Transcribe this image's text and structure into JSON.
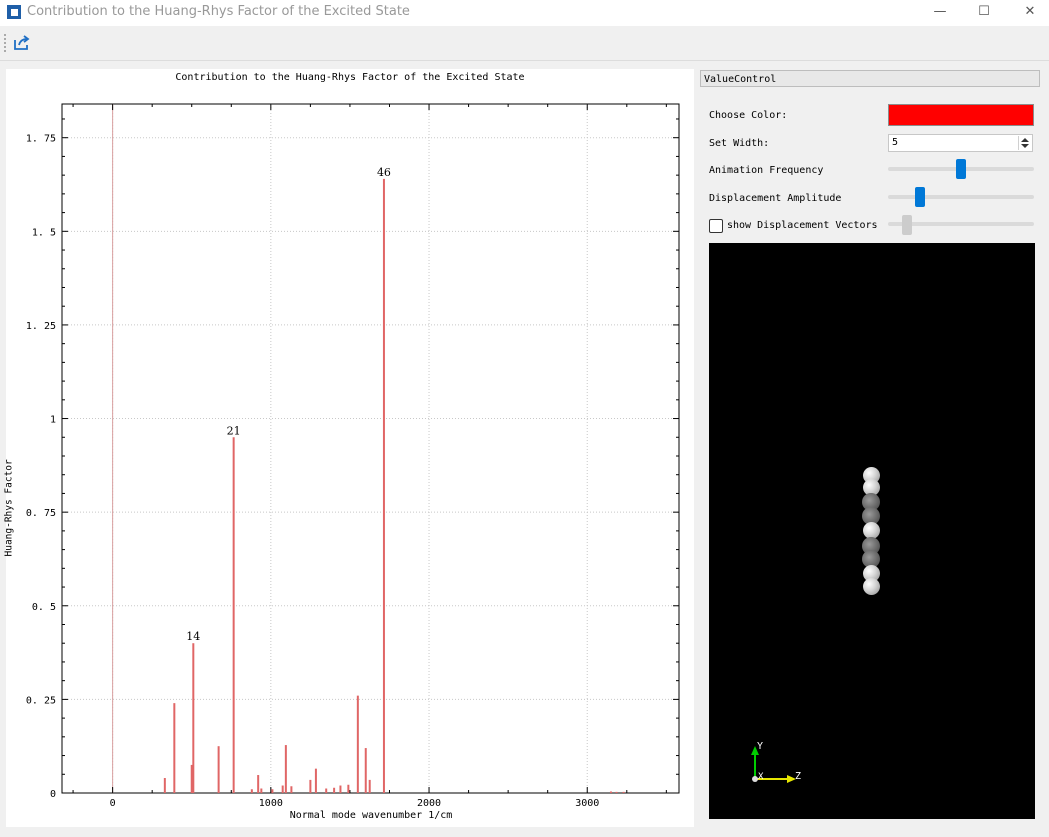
{
  "window": {
    "title": "Contribution to the Huang-Rhys Factor of the Excited State",
    "minimize": "—",
    "maximize": "☐",
    "close": "✕"
  },
  "toolbar": {
    "export_icon": "export-icon"
  },
  "chart_data": {
    "type": "bar",
    "title": "Contribution to the Huang-Rhys Factor of the Excited State",
    "xlabel": "Normal mode wavenumber 1/cm",
    "ylabel": "Huang-Rhys Factor",
    "xlim": [
      -320,
      3580
    ],
    "ylim": [
      0,
      1.84
    ],
    "xticks": [
      0,
      1000,
      2000,
      3000
    ],
    "yticks": [
      0,
      0.25,
      0.5,
      0.75,
      1,
      1.25,
      1.5,
      1.75
    ],
    "ytick_labels": [
      "0",
      "0. 25",
      "0. 5",
      "0. 75",
      "1",
      "1. 25",
      "1. 5",
      "1. 75"
    ],
    "grid": true,
    "bar_color": "#e06666",
    "bars": [
      {
        "x": 330,
        "y": 0.04
      },
      {
        "x": 390,
        "y": 0.24
      },
      {
        "x": 500,
        "y": 0.075
      },
      {
        "x": 510,
        "y": 0.4,
        "label": "14"
      },
      {
        "x": 670,
        "y": 0.125
      },
      {
        "x": 765,
        "y": 0.95,
        "label": "21"
      },
      {
        "x": 880,
        "y": 0.01
      },
      {
        "x": 920,
        "y": 0.048
      },
      {
        "x": 940,
        "y": 0.012
      },
      {
        "x": 1010,
        "y": 0.01
      },
      {
        "x": 1075,
        "y": 0.02
      },
      {
        "x": 1095,
        "y": 0.128
      },
      {
        "x": 1130,
        "y": 0.018
      },
      {
        "x": 1250,
        "y": 0.035
      },
      {
        "x": 1285,
        "y": 0.065
      },
      {
        "x": 1350,
        "y": 0.012
      },
      {
        "x": 1400,
        "y": 0.014
      },
      {
        "x": 1440,
        "y": 0.02
      },
      {
        "x": 1490,
        "y": 0.022
      },
      {
        "x": 1550,
        "y": 0.26
      },
      {
        "x": 1600,
        "y": 0.12
      },
      {
        "x": 1625,
        "y": 0.035
      },
      {
        "x": 1715,
        "y": 1.64,
        "label": "46"
      },
      {
        "x": 3150,
        "y": 0.004
      },
      {
        "x": 3185,
        "y": 0.003
      },
      {
        "x": 3230,
        "y": 0.003
      }
    ]
  },
  "controls": {
    "header": "ValueControl",
    "choose_color_label": "Choose Color:",
    "color": "#ff0000",
    "set_width_label": "Set Width:",
    "width_value": "5",
    "animation_frequency_label": "Animation Frequency",
    "animation_frequency_level": 0.5,
    "displacement_amplitude_label": "Displacement Amplitude",
    "displacement_amplitude_level": 0.2,
    "show_vectors_label": "show Displacement Vectors",
    "show_vectors_checked": false,
    "vector_slider_level": 0.1
  },
  "viewport": {
    "axis_y_label": "Y",
    "axis_x_label": "X",
    "axis_z_label": "Z",
    "axis_colors": {
      "x": "#ff3333",
      "y": "#00cc00",
      "z": "#e6e600"
    }
  }
}
